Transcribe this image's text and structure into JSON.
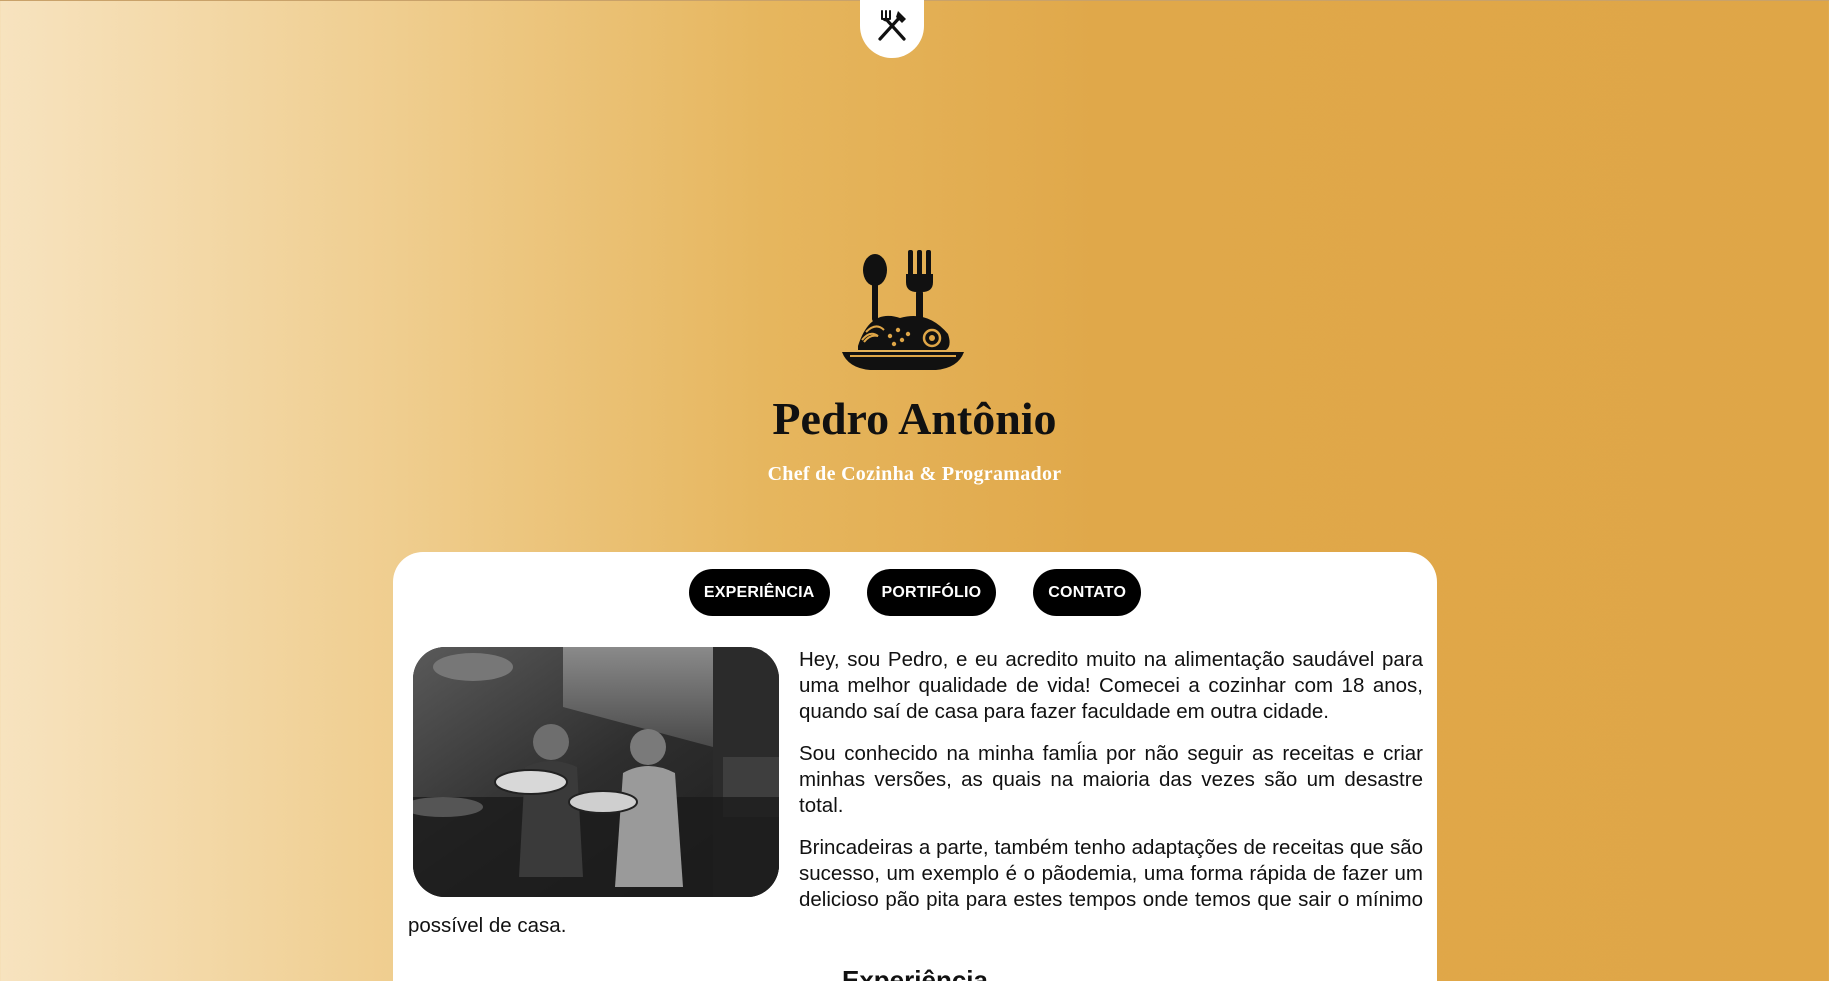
{
  "theme": {
    "accent": "#dfa647",
    "gradient_light": "#f7e3bf",
    "card_bg": "#ffffff",
    "button_bg": "#000000"
  },
  "top_tab": {
    "icon": "fork-knife-crossed-icon"
  },
  "hero": {
    "icon": "plate-spoon-fork-icon",
    "name": "Pedro Antônio",
    "subtitle": "Chef de Cozinha & Programador"
  },
  "nav": {
    "items": [
      {
        "label": "EXPERIÊNCIA"
      },
      {
        "label": "PORTIFÓLIO"
      },
      {
        "label": "CONTATO"
      }
    ]
  },
  "about": {
    "photo": "chefs-holding-pizzas-photo",
    "paragraphs": [
      "Hey, sou Pedro, e eu acredito muito na alimentação saudável para uma melhor qualidade de vida! Comecei a cozinhar com 18 anos, quando saí de casa para fazer faculdade em outra cidade.",
      "Sou conhecido na minha famĺia por não seguir as receitas e criar minhas versões, as quais na maioria das vezes são um desastre total.",
      "Brincadeiras a parte, também tenho adaptações de receitas que são sucesso, um exemplo é o pãodemia, uma forma rápida de fazer um delicioso pão pita para estes tempos onde temos que sair o mínimo possível de casa."
    ]
  },
  "section": {
    "title": "Experiência"
  }
}
